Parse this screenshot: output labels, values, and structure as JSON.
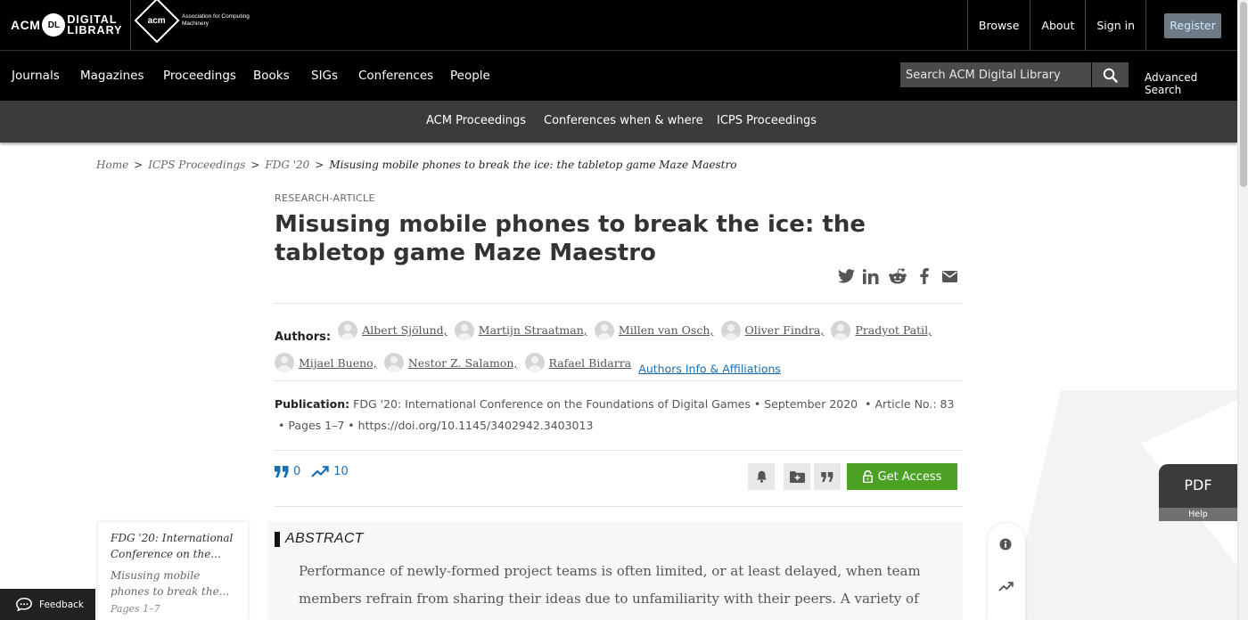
{
  "header": {
    "dl_logo": {
      "acm": "ACM",
      "badge": "DL",
      "line1": "DIGITAL",
      "line2": "LIBRARY"
    },
    "acm_logo": {
      "mark": "acm",
      "text": "Association for Computing Machinery"
    },
    "top_links": [
      "Browse",
      "About",
      "Sign in"
    ],
    "register_label": "Register"
  },
  "main_nav": {
    "items": [
      "Journals",
      "Magazines",
      "Proceedings",
      "Books",
      "SIGs",
      "Conferences",
      "People"
    ],
    "search_placeholder": "Search ACM Digital Library",
    "advanced_search": "Advanced Search"
  },
  "sub_nav": {
    "items": [
      "ACM Proceedings",
      "Conferences when & where",
      "ICPS Proceedings"
    ]
  },
  "breadcrumb": {
    "items": [
      "Home",
      "ICPS Proceedings",
      "FDG '20"
    ],
    "current": "Misusing mobile phones to break the ice: the tabletop game Maze Maestro"
  },
  "article": {
    "type": "RESEARCH-ARTICLE",
    "title": "Misusing mobile phones to break the ice: the tabletop game Maze Maestro",
    "share_icons": [
      "twitter-icon",
      "linkedin-icon",
      "reddit-icon",
      "facebook-icon",
      "email-icon"
    ],
    "authors_label": "Authors:",
    "authors": [
      "Albert Sjölund,",
      "Martijn Straatman,",
      "Millen van Osch,",
      "Oliver Findra,",
      "Pradyot Patil,",
      "Mijael Bueno,",
      "Nestor Z. Salamon,",
      "Rafael Bidarra"
    ],
    "authors_info_link": "Authors Info & Affiliations",
    "publication_label": "Publication:",
    "publication_venue": "FDG '20: International Conference on the Foundations of Digital Games",
    "publication_date": "September 2020",
    "article_no": "Article No.: 83",
    "pages": "Pages 1–7",
    "doi": "https://doi.org/10.1145/3402942.3403013",
    "citations": "0",
    "downloads": "10",
    "get_access": "Get Access",
    "abstract_heading": "ABSTRACT",
    "abstract_text": "Performance of newly-formed project teams is often limited, or at least delayed, when team members refrain from sharing their ideas due to unfamiliarity with their peers. A variety of"
  },
  "side_card": {
    "conference": "FDG '20: International Conference on the...",
    "title": "Misusing mobile phones to break the...",
    "pages": "Pages 1–7"
  },
  "pdf_tab": {
    "label": "PDF",
    "help": "Help"
  },
  "feedback_label": "Feedback",
  "colors": {
    "access_green": "#4ba224",
    "link_blue": "#1a6fb4",
    "nav_black": "#000000",
    "subnav_gray": "#3b3b3b"
  }
}
